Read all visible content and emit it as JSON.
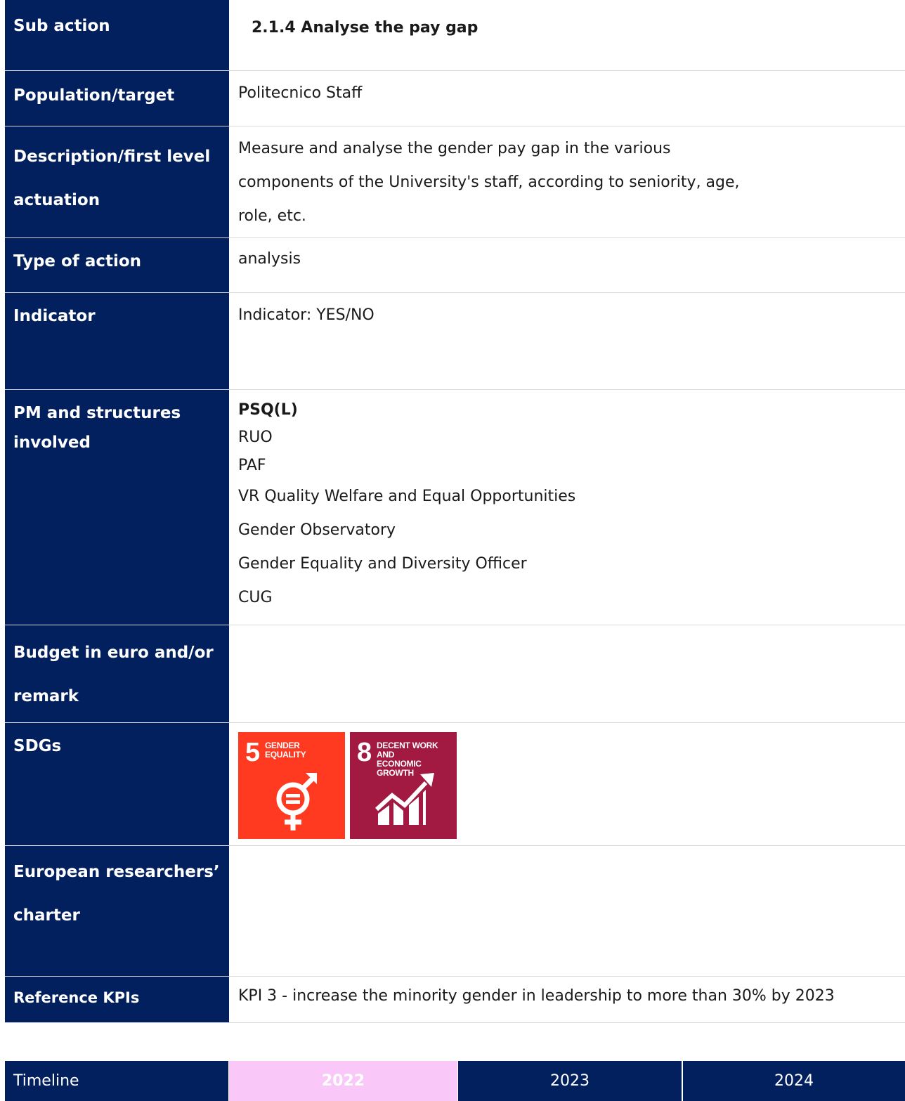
{
  "rows": {
    "sub_action": {
      "label": "Sub action",
      "value": "2.1.4 Analyse the pay gap"
    },
    "population": {
      "label": "Population/target",
      "value": "Politecnico Staff"
    },
    "description": {
      "label": "Description/first level actuation",
      "lines": [
        "Measure and analyse the gender pay gap in the various",
        "components of the University's staff, according to seniority, age,",
        "role, etc."
      ]
    },
    "type_of_action": {
      "label": "Type of action",
      "value": "analysis"
    },
    "indicator": {
      "label": "Indicator",
      "value": "Indicator: YES/NO"
    },
    "pm_structures": {
      "label": "PM and structures involved",
      "lead": "PSQ(L)",
      "items": [
        "RUO",
        "PAF",
        "VR Quality Welfare and Equal Opportunities",
        "Gender Observatory",
        "Gender Equality and Diversity Officer",
        "CUG"
      ]
    },
    "budget": {
      "label": "Budget in euro and/or remark",
      "value": ""
    },
    "sdgs": {
      "label": "SDGs",
      "tiles": [
        {
          "number": "5",
          "title_line1": "GENDER",
          "title_line2": "EQUALITY",
          "color": "#ff3a21",
          "icon": "gender-equality-icon"
        },
        {
          "number": "8",
          "title_line1": "DECENT WORK AND",
          "title_line2": "ECONOMIC GROWTH",
          "color": "#a21942",
          "icon": "economic-growth-icon"
        }
      ]
    },
    "european_charter": {
      "label": "European researchers’ charter",
      "value": ""
    },
    "reference_kpis": {
      "label": "Reference KPIs",
      "value": "KPI 3 - increase the minority gender in leadership to more than 30% by 2023"
    }
  },
  "timeline": {
    "label": "Timeline",
    "years": [
      "2022",
      "2023",
      "2024"
    ],
    "active_year": "2022",
    "active_color": "#f9c8f8"
  },
  "colors": {
    "header_navy": "#03205e",
    "divider": "#d9d9d9"
  }
}
